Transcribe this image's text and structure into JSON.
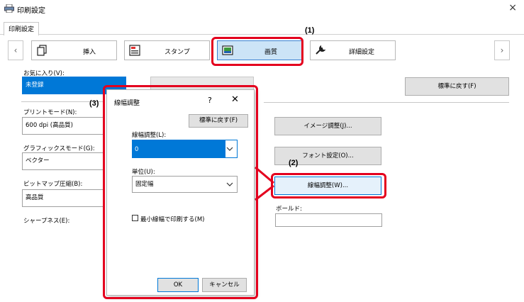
{
  "window": {
    "title": "印刷設定",
    "close": "×"
  },
  "tabs": [
    {
      "label": "印刷設定"
    }
  ],
  "toolbar": {
    "prev": "‹",
    "next": "›",
    "items": [
      {
        "label": "挿入"
      },
      {
        "label": "スタンプ"
      },
      {
        "label": "画質"
      },
      {
        "label": "詳細設定"
      }
    ]
  },
  "left": {
    "favorites_label": "お気に入り(V):",
    "favorites_value": "未登録",
    "print_mode_label": "プリントモード(N):",
    "print_mode_value": "600 dpi (高品質)",
    "graphics_mode_label": "グラフィックスモード(G):",
    "graphics_mode_value": "ベクター",
    "bitmap_label": "ビットマップ圧縮(B):",
    "bitmap_value": "高品質",
    "more_label": "シャープネス(E):"
  },
  "right": {
    "reset_button": "標準に戻す(F)",
    "image_adjust_button": "イメージ調整(J)...",
    "font_settings_button": "フォント設定(O)...",
    "line_width_button": "線幅調整(W)...",
    "bold_label": "ボールド:"
  },
  "dialog": {
    "title": "線幅調整",
    "help": "?",
    "close": "✕",
    "reset_button": "標準に戻す(F)",
    "line_width_label": "線幅調整(L):",
    "line_width_value": "0",
    "unit_label": "単位(U):",
    "unit_value": "固定幅",
    "min_width_checkbox": "最小線幅で印刷する(M)",
    "ok_button": "OK",
    "cancel_button": "キャンセル"
  },
  "callouts": {
    "one": "(1)",
    "two": "(2)",
    "three": "(3)"
  },
  "colors": {
    "accent": "#0078d7",
    "callout": "#e4001e",
    "selected_tab": "#cce4f7"
  }
}
